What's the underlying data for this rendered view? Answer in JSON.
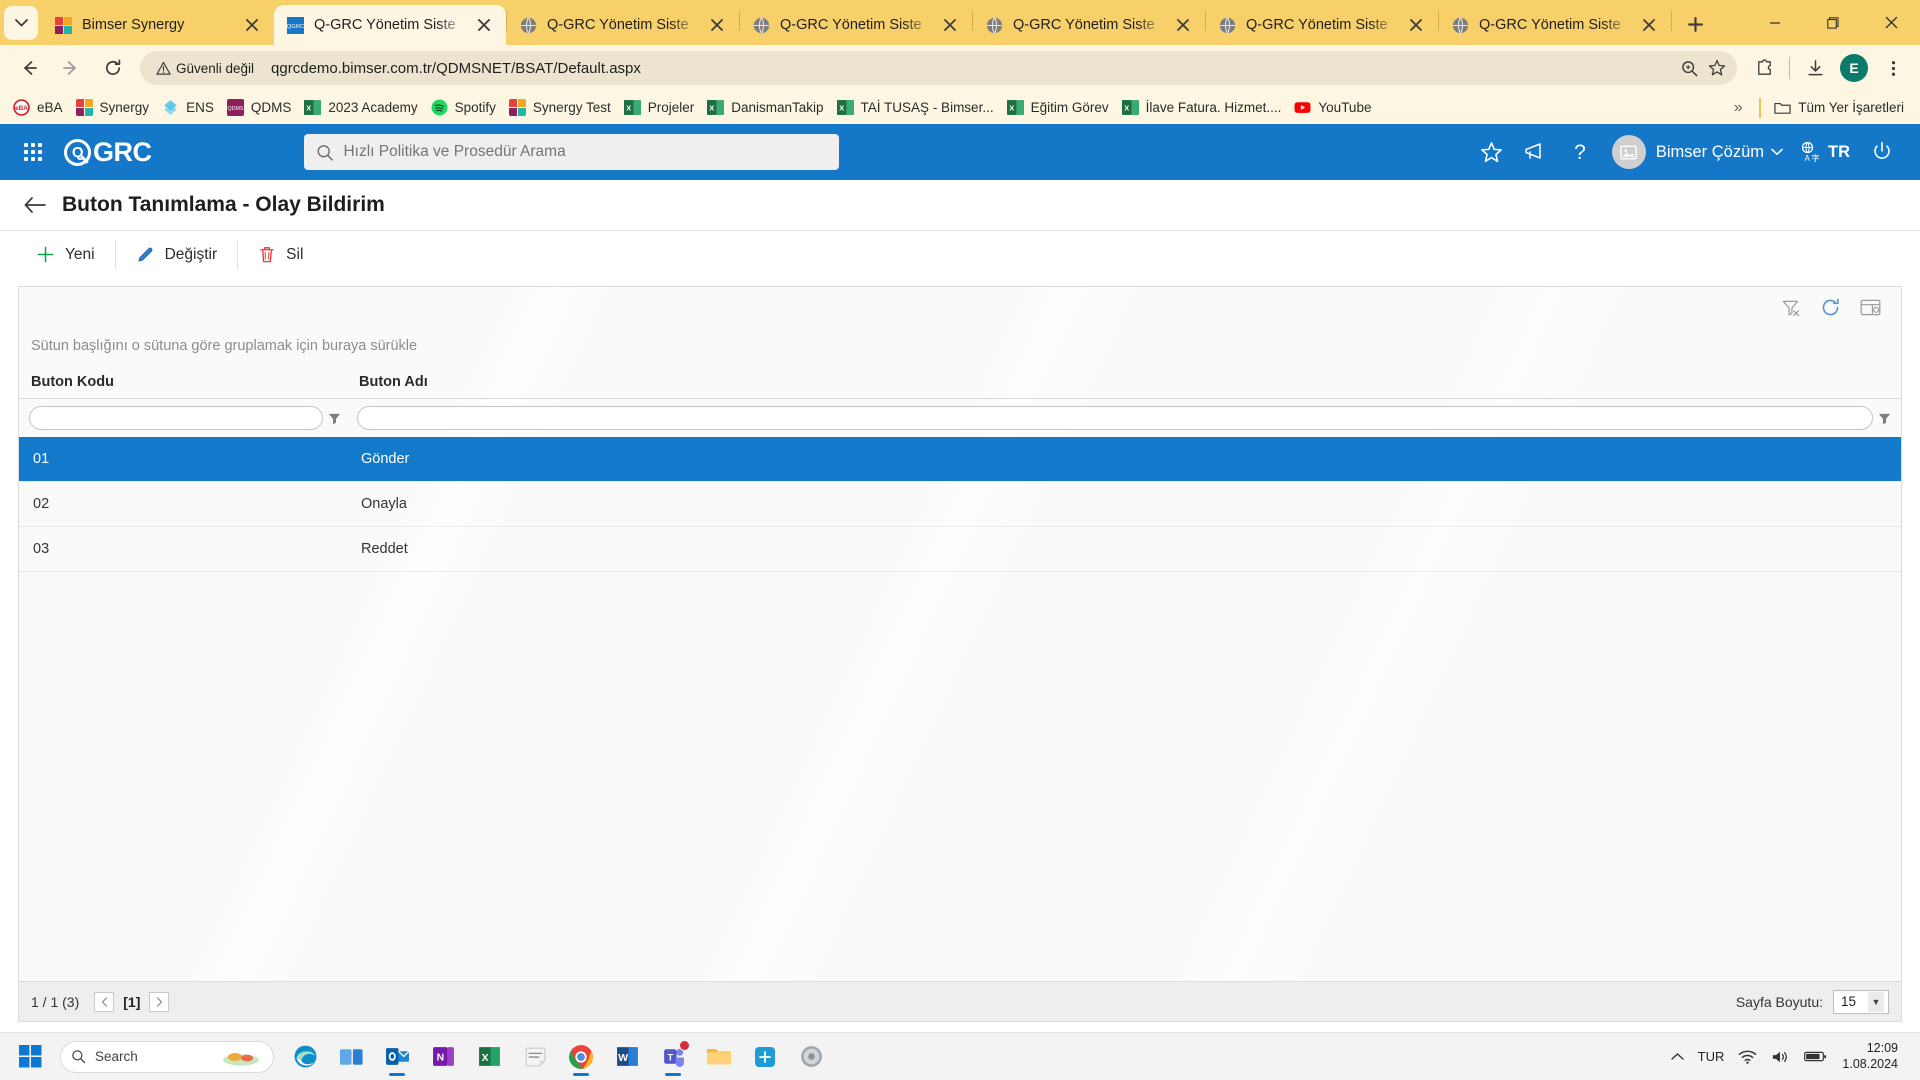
{
  "browser": {
    "tab_search_icon": "chevron-down-icon",
    "tabs": [
      {
        "title": "Bimser Synergy",
        "favicon": "bimser-synergy-icon",
        "active": false
      },
      {
        "title": "Q-GRC Yönetim Siste",
        "favicon": "qgrc-icon",
        "active": true
      },
      {
        "title": "Q-GRC Yönetim Siste",
        "favicon": "globe-icon",
        "active": false
      },
      {
        "title": "Q-GRC Yönetim Siste",
        "favicon": "globe-icon",
        "active": false
      },
      {
        "title": "Q-GRC Yönetim Siste",
        "favicon": "globe-icon",
        "active": false
      },
      {
        "title": "Q-GRC Yönetim Siste",
        "favicon": "globe-icon",
        "active": false
      },
      {
        "title": "Q-GRC Yönetim Siste",
        "favicon": "globe-icon",
        "active": false
      }
    ],
    "new_tab_label": "+",
    "window_controls": {
      "minimize": "minimize-icon",
      "maximize": "maximize-icon",
      "close": "close-icon"
    },
    "toolbar": {
      "back": "back-arrow-icon",
      "forward": "forward-arrow-icon",
      "reload": "reload-icon",
      "security_label": "Güvenli değil",
      "url": "qgrcdemo.bimser.com.tr/QDMSNET/BSAT/Default.aspx",
      "zoom_icon": "zoom-search-icon",
      "bookmark_icon": "star-icon",
      "extensions_icon": "puzzle-icon",
      "downloads_icon": "download-icon",
      "profile_initial": "E",
      "menu_icon": "three-dots-icon"
    },
    "bookmarks": [
      {
        "label": "eBA",
        "icon": "eba-icon"
      },
      {
        "label": "Synergy",
        "icon": "synergy-icon"
      },
      {
        "label": "ENS",
        "icon": "ens-icon"
      },
      {
        "label": "QDMS",
        "icon": "qdms-icon"
      },
      {
        "label": "2023 Academy",
        "icon": "excel-icon"
      },
      {
        "label": "Spotify",
        "icon": "spotify-icon"
      },
      {
        "label": "Synergy Test",
        "icon": "synergy-icon"
      },
      {
        "label": "Projeler",
        "icon": "excel-icon"
      },
      {
        "label": "DanismanTakip",
        "icon": "excel-icon"
      },
      {
        "label": "TAİ TUSAŞ - Bimser...",
        "icon": "excel-icon"
      },
      {
        "label": "Eğitim Görev",
        "icon": "excel-icon"
      },
      {
        "label": "İlave Fatura. Hizmet....",
        "icon": "excel-icon"
      },
      {
        "label": "YouTube",
        "icon": "youtube-icon"
      }
    ],
    "bookmarks_overflow": "»",
    "all_bookmarks_label": "Tüm Yer İşaretleri"
  },
  "app": {
    "brand": "GRC",
    "apps_icon": "app-grid-icon",
    "search": {
      "placeholder": "Hızlı Politika ve Prosedür Arama",
      "value": "",
      "icon": "search-icon"
    },
    "header_icons": [
      {
        "name": "favorites-star-icon"
      },
      {
        "name": "announcement-icon"
      },
      {
        "name": "help-question-icon"
      }
    ],
    "user": {
      "name": "Bimser Çözüm",
      "avatar_icon": "user-avatar-icon",
      "chevron": "chevron-down-icon"
    },
    "language": {
      "label": "TR",
      "icon": "translate-icon"
    },
    "power_icon": "power-icon"
  },
  "page": {
    "back_icon": "back-arrow-icon",
    "title": "Buton Tanımlama - Olay Bildirim",
    "commands": [
      {
        "label": "Yeni",
        "icon": "plus-icon"
      },
      {
        "label": "Değiştir",
        "icon": "pencil-icon"
      },
      {
        "label": "Sil",
        "icon": "trash-icon"
      }
    ]
  },
  "grid": {
    "toolbar_icons": [
      {
        "name": "clear-filter-icon"
      },
      {
        "name": "refresh-icon"
      },
      {
        "name": "column-chooser-icon"
      }
    ],
    "group_hint": "Sütun başlığını o sütuna göre gruplamak için buraya sürükle",
    "columns": [
      {
        "header": "Buton Kodu",
        "filter_value": "",
        "filter_icon": "funnel-icon"
      },
      {
        "header": "Buton Adı",
        "filter_value": "",
        "filter_icon": "funnel-icon"
      }
    ],
    "rows": [
      {
        "code": "01",
        "name": "Gönder",
        "selected": true
      },
      {
        "code": "02",
        "name": "Onayla",
        "selected": false
      },
      {
        "code": "03",
        "name": "Reddet",
        "selected": false
      }
    ],
    "footer": {
      "page_info": "1 / 1 (3)",
      "prev_icon": "chevron-left-icon",
      "current_page": "[1]",
      "next_icon": "chevron-right-icon",
      "page_size_label": "Sayfa Boyutu:",
      "page_size_value": "15"
    }
  },
  "taskbar": {
    "start_icon": "windows-start-icon",
    "search_placeholder": "Search",
    "apps": [
      {
        "name": "edge-icon"
      },
      {
        "name": "task-view-icon"
      },
      {
        "name": "outlook-icon"
      },
      {
        "name": "onenote-icon"
      },
      {
        "name": "excel-icon"
      },
      {
        "name": "sticky-notes-icon"
      },
      {
        "name": "chrome-icon"
      },
      {
        "name": "word-icon"
      },
      {
        "name": "teams-icon"
      },
      {
        "name": "file-explorer-icon"
      },
      {
        "name": "app-blue-icon"
      },
      {
        "name": "settings-icon"
      }
    ],
    "tray": {
      "overflow_icon": "chevron-up-icon",
      "language": "TUR",
      "network_icon": "wifi-icon",
      "volume_icon": "speaker-icon",
      "battery_icon": "battery-icon",
      "time": "12:09",
      "date": "1.08.2024"
    }
  },
  "colors": {
    "browser_theme": "#f8d06a",
    "chrome_surface": "#fdf6e3",
    "app_blue": "#1477c8",
    "row_selected": "#1279cb",
    "new_green": "#17a04b",
    "delete_red": "#e03b3b",
    "edit_blue": "#2b7fd4"
  }
}
